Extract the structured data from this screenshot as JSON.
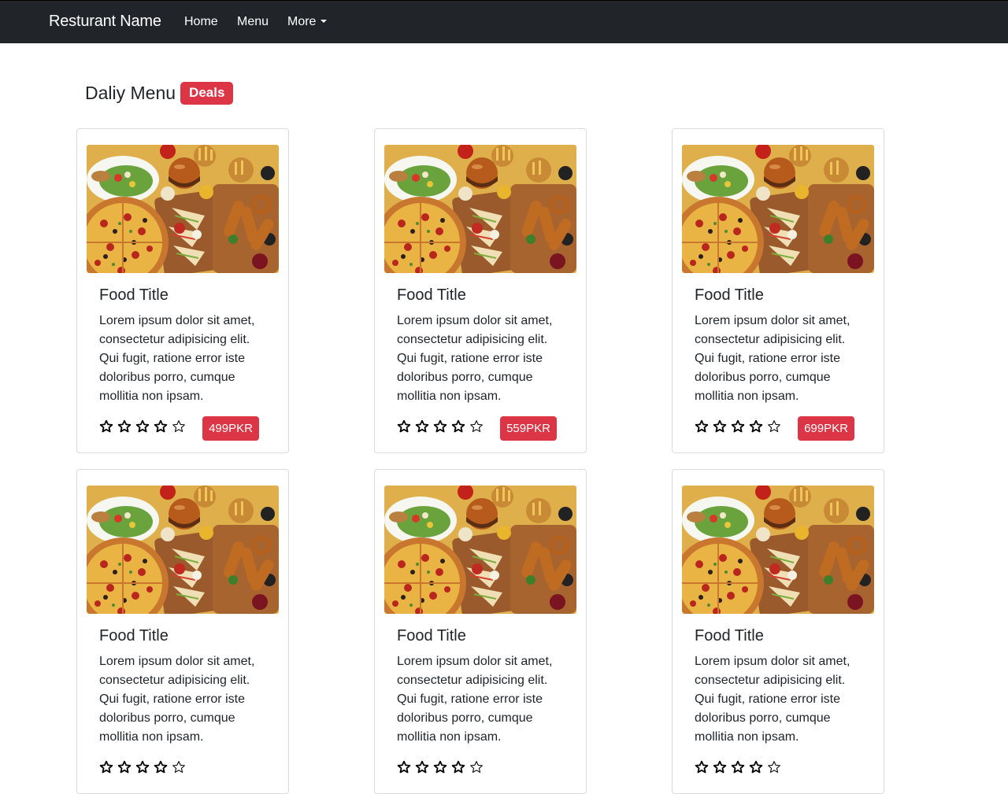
{
  "navbar": {
    "brand": "Resturant Name",
    "links": [
      "Home",
      "Menu",
      "More"
    ]
  },
  "section": {
    "title": "Daliy Menu",
    "badge": "Deals"
  },
  "colors": {
    "navbar": "#212529",
    "accent": "#dc3545"
  },
  "cards": [
    {
      "title": "Food Title",
      "text": "Lorem ipsum dolor sit amet, consectetur adipisicing elit. Qui fugit, ratione error iste doloribus porro, cumque mollitia non ipsam.",
      "rating": 0,
      "price": "499PKR"
    },
    {
      "title": "Food Title",
      "text": "Lorem ipsum dolor sit amet, consectetur adipisicing elit. Qui fugit, ratione error iste doloribus porro, cumque mollitia non ipsam.",
      "rating": 0,
      "price": "559PKR"
    },
    {
      "title": "Food Title",
      "text": "Lorem ipsum dolor sit amet, consectetur adipisicing elit. Qui fugit, ratione error iste doloribus porro, cumque mollitia non ipsam.",
      "rating": 0,
      "price": "699PKR"
    },
    {
      "title": "Food Title",
      "text": "Lorem ipsum dolor sit amet, consectetur adipisicing elit. Qui fugit, ratione error iste doloribus porro, cumque mollitia non ipsam.",
      "rating": 0,
      "price": ""
    },
    {
      "title": "Food Title",
      "text": "Lorem ipsum dolor sit amet, consectetur adipisicing elit. Qui fugit, ratione error iste doloribus porro, cumque mollitia non ipsam.",
      "rating": 0,
      "price": ""
    },
    {
      "title": "Food Title",
      "text": "Lorem ipsum dolor sit amet, consectetur adipisicing elit. Qui fugit, ratione error iste doloribus porro, cumque mollitia non ipsam.",
      "rating": 0,
      "price": ""
    }
  ]
}
